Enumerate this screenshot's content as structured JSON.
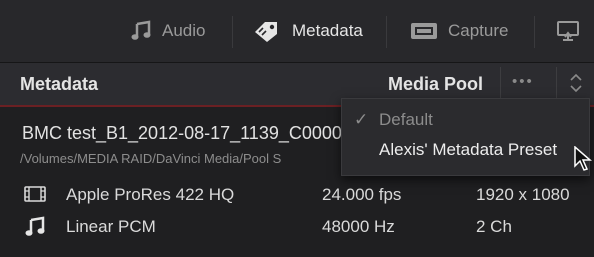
{
  "toolbar": {
    "tabs": [
      {
        "label": "Audio",
        "icon": "music-note-icon"
      },
      {
        "label": "Metadata",
        "icon": "tag-icon"
      },
      {
        "label": "Capture",
        "icon": "tape-icon"
      },
      {
        "label": "",
        "icon": "monitor-icon"
      }
    ]
  },
  "header": {
    "title": "Metadata",
    "pool_label": "Media Pool",
    "options_glyph": "•••"
  },
  "clip": {
    "name": "BMC test_B1_2012-08-17_1139_C0000",
    "path": "/Volumes/MEDIA RAID/DaVinci Media/Pool S"
  },
  "rows": [
    {
      "icon": "film-icon",
      "col1": "Apple ProRes 422 HQ",
      "col2": "24.000 fps",
      "col3": "1920 x 1080"
    },
    {
      "icon": "music-note-icon",
      "col1": "Linear PCM",
      "col2": "48000 Hz",
      "col3": "2 Ch"
    }
  ],
  "menu": {
    "items": [
      {
        "label": "Default",
        "checked": true,
        "check_glyph": "✓"
      },
      {
        "label": "Alexis' Metadata Preset",
        "checked": false,
        "highlighted": true
      }
    ]
  },
  "colors": {
    "accent_underline": "#6b2023",
    "background": "#1f1f21",
    "toolbar": "#28282b"
  }
}
